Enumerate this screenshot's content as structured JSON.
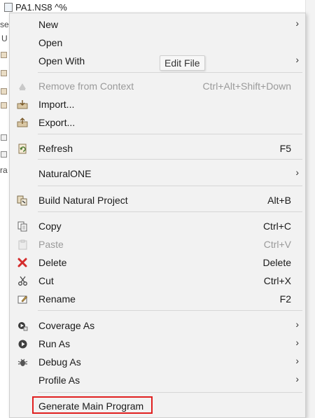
{
  "tree": {
    "top_item_label": "PA1.NS8 ^%",
    "side_fragments": [
      "se",
      "U",
      "ra"
    ]
  },
  "tooltip": {
    "text": "Edit File"
  },
  "menu": {
    "items": [
      {
        "id": "new",
        "label": "New",
        "shortcut": "",
        "submenu": true,
        "disabled": false,
        "icon": ""
      },
      {
        "id": "open",
        "label": "Open",
        "shortcut": "",
        "submenu": false,
        "disabled": false,
        "icon": ""
      },
      {
        "id": "open-with",
        "label": "Open With",
        "shortcut": "",
        "submenu": true,
        "disabled": false,
        "icon": ""
      },
      {
        "id": "remove-from-context",
        "label": "Remove from Context",
        "shortcut": "Ctrl+Alt+Shift+Down",
        "submenu": false,
        "disabled": true,
        "icon": "remove-context-icon"
      },
      {
        "id": "import",
        "label": "Import...",
        "shortcut": "",
        "submenu": false,
        "disabled": false,
        "icon": "import-icon"
      },
      {
        "id": "export",
        "label": "Export...",
        "shortcut": "",
        "submenu": false,
        "disabled": false,
        "icon": "export-icon"
      },
      {
        "id": "refresh",
        "label": "Refresh",
        "shortcut": "F5",
        "submenu": false,
        "disabled": false,
        "icon": "refresh-icon"
      },
      {
        "id": "naturalone",
        "label": "NaturalONE",
        "shortcut": "",
        "submenu": true,
        "disabled": false,
        "icon": ""
      },
      {
        "id": "build-natural-project",
        "label": "Build Natural Project",
        "shortcut": "Alt+B",
        "submenu": false,
        "disabled": false,
        "icon": "build-icon"
      },
      {
        "id": "copy",
        "label": "Copy",
        "shortcut": "Ctrl+C",
        "submenu": false,
        "disabled": false,
        "icon": "copy-icon"
      },
      {
        "id": "paste",
        "label": "Paste",
        "shortcut": "Ctrl+V",
        "submenu": false,
        "disabled": true,
        "icon": "paste-icon"
      },
      {
        "id": "delete",
        "label": "Delete",
        "shortcut": "Delete",
        "submenu": false,
        "disabled": false,
        "icon": "delete-icon"
      },
      {
        "id": "cut",
        "label": "Cut",
        "shortcut": "Ctrl+X",
        "submenu": false,
        "disabled": false,
        "icon": "cut-icon"
      },
      {
        "id": "rename",
        "label": "Rename",
        "shortcut": "F2",
        "submenu": false,
        "disabled": false,
        "icon": "rename-icon"
      },
      {
        "id": "coverage-as",
        "label": "Coverage As",
        "shortcut": "",
        "submenu": true,
        "disabled": false,
        "icon": "coverage-icon"
      },
      {
        "id": "run-as",
        "label": "Run As",
        "shortcut": "",
        "submenu": true,
        "disabled": false,
        "icon": "run-icon"
      },
      {
        "id": "debug-as",
        "label": "Debug As",
        "shortcut": "",
        "submenu": true,
        "disabled": false,
        "icon": "debug-icon"
      },
      {
        "id": "profile-as",
        "label": "Profile As",
        "shortcut": "",
        "submenu": true,
        "disabled": false,
        "icon": ""
      },
      {
        "id": "generate-main-program",
        "label": "Generate Main Program",
        "shortcut": "",
        "submenu": false,
        "disabled": false,
        "icon": ""
      }
    ],
    "arrow_glyph": "›"
  },
  "colors": {
    "menu_bg": "#f2f2f2",
    "disabled_text": "#9a9a9a",
    "highlight_border": "#e02020",
    "delete_icon": "#d42b2b",
    "run_icon": "#3f3f3f"
  }
}
